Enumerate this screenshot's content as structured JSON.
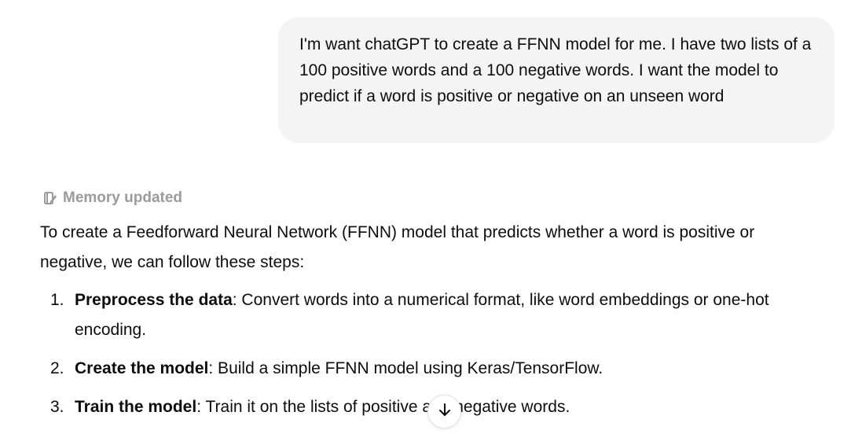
{
  "conversation": {
    "user_message": "I'm want chatGPT to create a FFNN model for me. I have two lists of a 100 positive words and a 100 negative words. I want the model to predict if a word is positive or negative on an unseen word",
    "memory_status": "Memory updated",
    "assistant_intro": "To create a Feedforward Neural Network (FFNN) model that predicts whether a word is positive or negative, we can follow these steps:",
    "steps": [
      {
        "number": "1.",
        "title": "Preprocess the data",
        "text": ": Convert words into a numerical format, like word embeddings or one-hot encoding."
      },
      {
        "number": "2.",
        "title": "Create the model",
        "text": ": Build a simple FFNN model using Keras/TensorFlow."
      },
      {
        "number": "3.",
        "title": "Train the model",
        "text": ": Train it on the lists of positive and negative words."
      }
    ]
  },
  "icons": {
    "memory": "memory-edit-icon",
    "scroll": "arrow-down-icon"
  },
  "colors": {
    "user_bubble_bg": "#f4f4f4",
    "memory_text": "#9b9b9b",
    "body_text": "#0d0d0d"
  }
}
